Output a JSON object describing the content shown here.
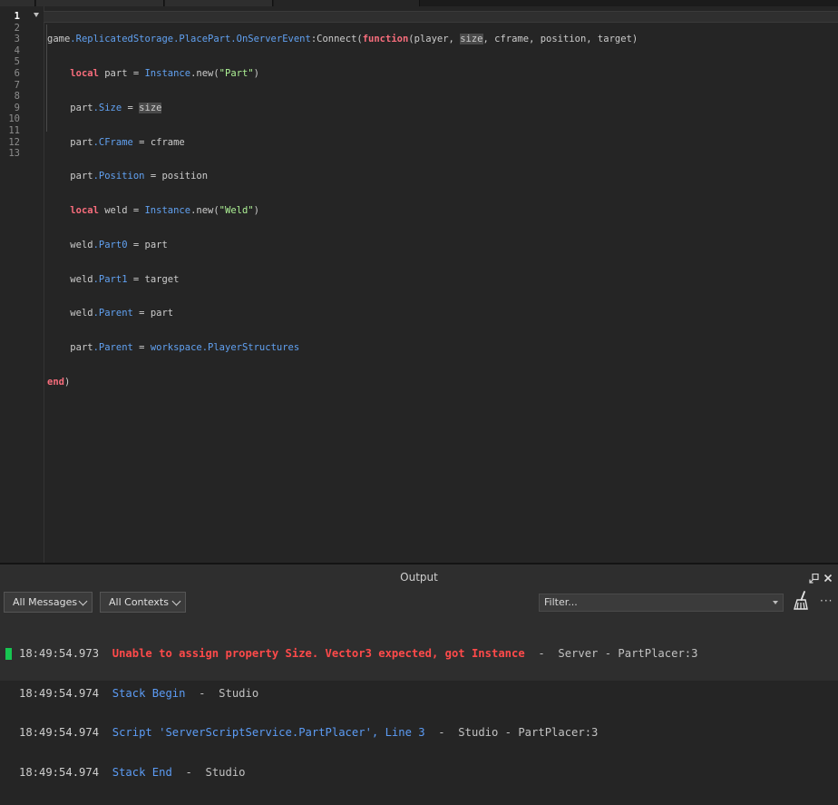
{
  "editor": {
    "line_numbers": [
      "1",
      "2",
      "3",
      "4",
      "5",
      "6",
      "7",
      "8",
      "9",
      "10",
      "11",
      "12",
      "13"
    ],
    "current_line": "1",
    "code": {
      "l1": {
        "a": "game",
        "b": ".ReplicatedStorage.PlacePart.OnServerEvent",
        "c": ":Connect(",
        "kw": "function",
        "d": "(player, ",
        "hl": "size",
        "e": ", cframe, position, target)"
      },
      "l2": {
        "kw": "local",
        "a": " part = ",
        "b": "Instance",
        "c": ".new(",
        "s": "\"Part\"",
        "d": ")"
      },
      "l3": {
        "a": "part",
        "b": ".Size",
        "c": " = ",
        "hl": "size"
      },
      "l4": {
        "a": "part",
        "b": ".CFrame",
        "c": " = cframe"
      },
      "l5": {
        "a": "part",
        "b": ".Position",
        "c": " = position"
      },
      "l6": {
        "kw": "local",
        "a": " weld = ",
        "b": "Instance",
        "c": ".new(",
        "s": "\"Weld\"",
        "d": ")"
      },
      "l7": {
        "a": "weld",
        "b": ".Part0",
        "c": " = part"
      },
      "l8": {
        "a": "weld",
        "b": ".Part1",
        "c": " = target"
      },
      "l9": {
        "a": "weld",
        "b": ".Parent",
        "c": " = part"
      },
      "l10": {
        "a": "part",
        "b": ".Parent",
        "c": " = ",
        "d": "workspace.PlayerStructures"
      },
      "l11": {
        "kw": "end",
        "a": ")"
      }
    }
  },
  "output": {
    "title": "Output",
    "message_filter": "All Messages",
    "context_filter": "All Contexts",
    "filter_placeholder": "Filter...",
    "lines": [
      {
        "time": "18:49:54.973",
        "message": "Unable to assign property Size. Vector3 expected, got Instance",
        "source": "  -  Server - PartPlacer:3",
        "kind": "error"
      },
      {
        "time": "18:49:54.974",
        "message": "Stack Begin",
        "source": "  -  Studio",
        "kind": "info"
      },
      {
        "time": "18:49:54.974",
        "message": "Script 'ServerScriptService.PartPlacer', Line 3",
        "source": "  -  Studio - PartPlacer:3",
        "kind": "info"
      },
      {
        "time": "18:49:54.974",
        "message": "Stack End",
        "source": "  -  Studio",
        "kind": "info"
      }
    ]
  },
  "icons": {
    "undock": "undock-icon",
    "close": "close-icon",
    "clear": "broom-icon",
    "more": "more-icon",
    "fold": "fold-arrow-icon"
  },
  "colors": {
    "error": "#ff4a4a",
    "info": "#5c9cf5",
    "keyword": "#f86d7c",
    "property": "#61a1f1",
    "string": "#adf195",
    "active_marker": "#17c651"
  }
}
